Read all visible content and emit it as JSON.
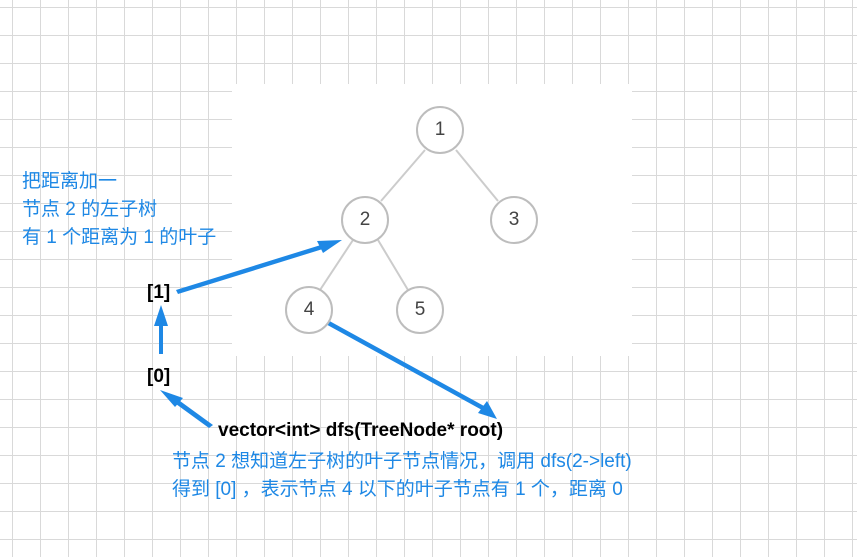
{
  "tree": {
    "nodes": [
      {
        "id": "1",
        "label": "1"
      },
      {
        "id": "2",
        "label": "2"
      },
      {
        "id": "3",
        "label": "3"
      },
      {
        "id": "4",
        "label": "4"
      },
      {
        "id": "5",
        "label": "5"
      }
    ],
    "edges": [
      [
        "1",
        "2"
      ],
      [
        "1",
        "3"
      ],
      [
        "2",
        "4"
      ],
      [
        "2",
        "5"
      ]
    ]
  },
  "annotations": {
    "top_note_lines": [
      "把距离加一",
      "节点 2 的左子树",
      "有 1 个距离为 1 的叶子"
    ],
    "bracket_upper": "[1]",
    "bracket_lower": "[0]",
    "function_signature": "vector<int> dfs(TreeNode* root)",
    "bottom_note_lines": [
      "节点 2 想知道左子树的叶子节点情况，调用 dfs(2->left)",
      "得到 [0] ，表示节点 4 以下的叶子节点有 1 个，距离 0"
    ]
  },
  "colors": {
    "arrow": "#1e88e5",
    "note_text": "#1e88e5",
    "node_border": "#bdbdbd",
    "edge": "#cccccc",
    "grid": "#d9d9d9"
  }
}
